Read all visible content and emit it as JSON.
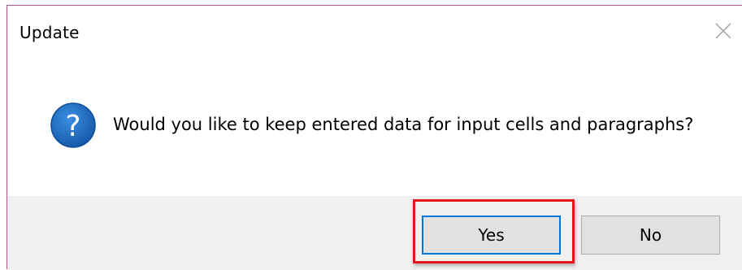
{
  "dialog": {
    "title": "Update",
    "message": "Would you like to keep entered data for input cells and paragraphs?",
    "icon": "question-icon",
    "buttons": {
      "yes_label": "Yes",
      "no_label": "No"
    }
  },
  "colors": {
    "accent": "#0078d7",
    "highlight": "#e8141c",
    "footer_bg": "#f0f0f0",
    "icon_blue": "#1c6fc4"
  }
}
